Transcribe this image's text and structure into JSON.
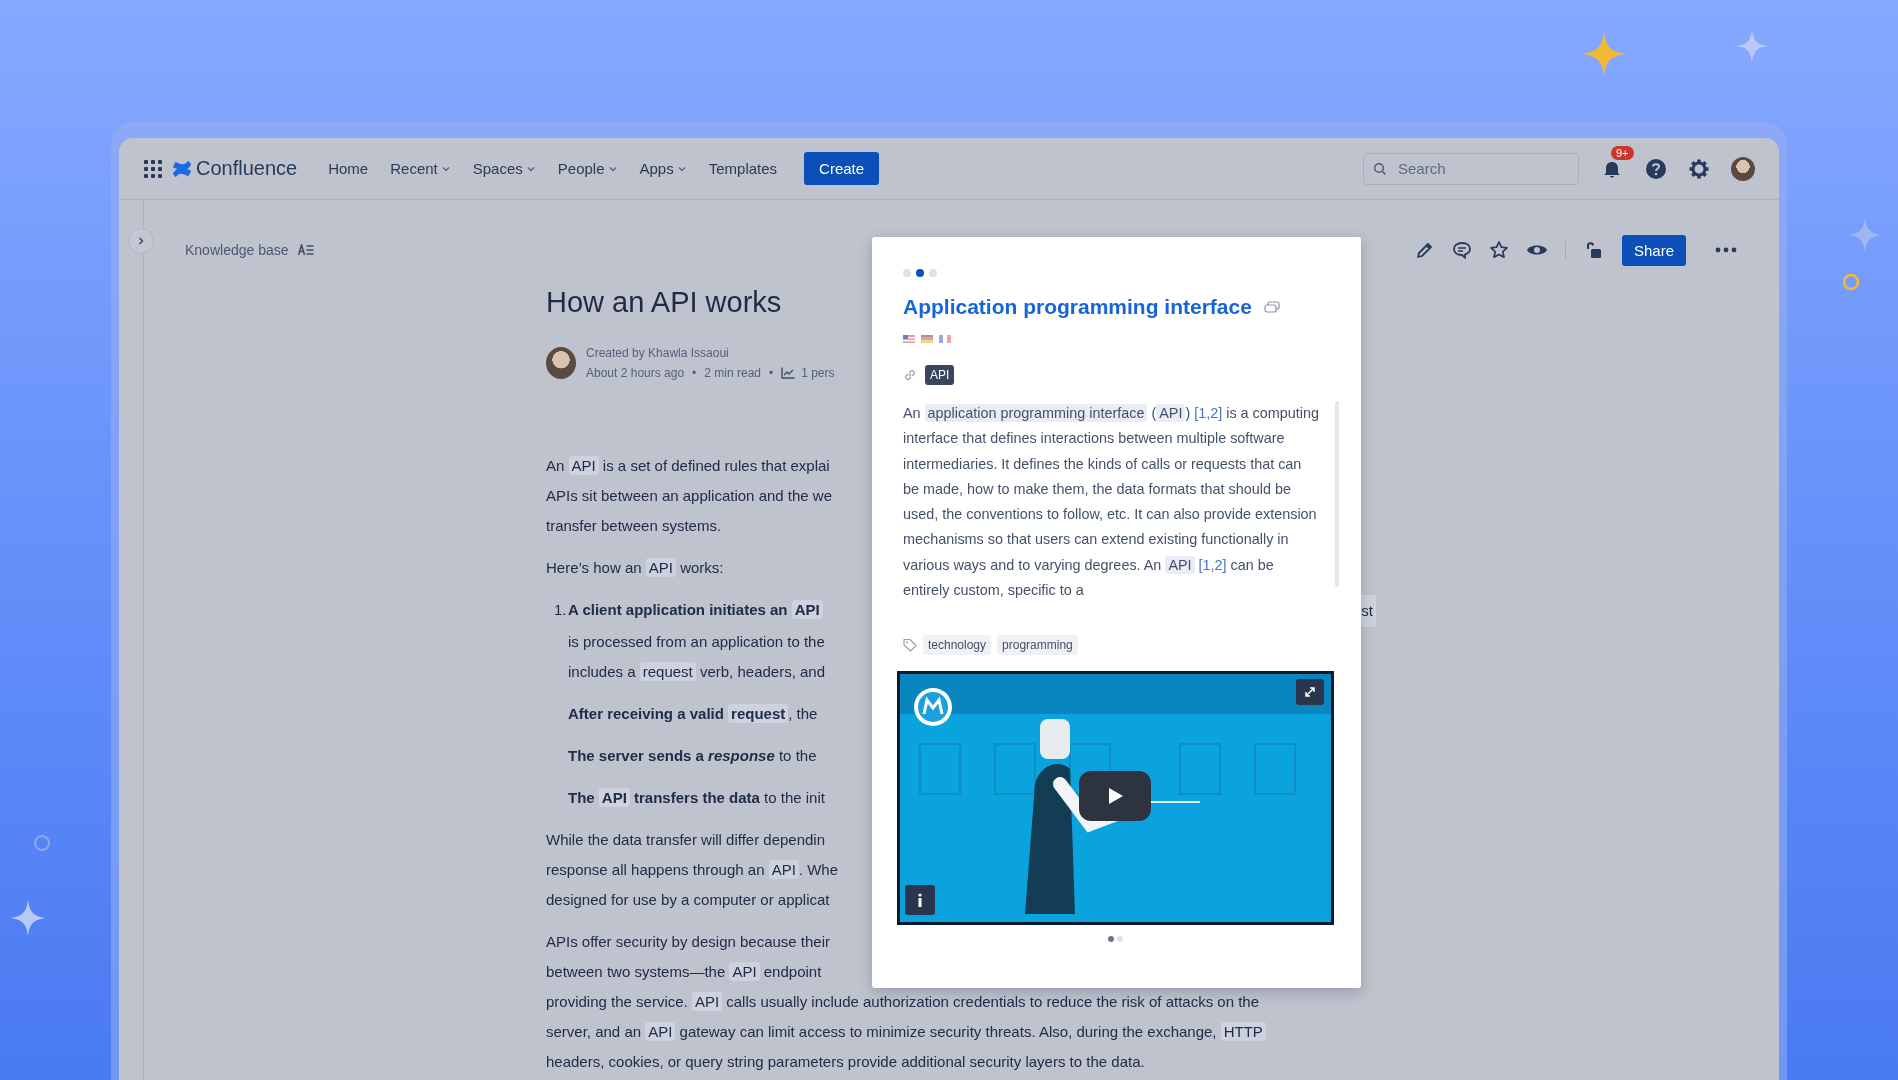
{
  "nav": {
    "product": "Confluence",
    "items": [
      {
        "label": "Home",
        "menu": false
      },
      {
        "label": "Recent",
        "menu": true
      },
      {
        "label": "Spaces",
        "menu": true
      },
      {
        "label": "People",
        "menu": true
      },
      {
        "label": "Apps",
        "menu": true
      },
      {
        "label": "Templates",
        "menu": false
      }
    ],
    "create": "Create",
    "search": {
      "placeholder": "Search"
    },
    "notifications": {
      "badge": "9+"
    }
  },
  "breadcrumb": "Knowledge base",
  "toolbar": {
    "share": "Share"
  },
  "page": {
    "title": "How an API works",
    "author": "Created by Khawla Issaoui",
    "meta": [
      "About 2 hours ago",
      "2 min read"
    ],
    "separator": "•",
    "views": "1 pers",
    "blocks": [
      {
        "kind": "para",
        "lines": [
          {
            "segments": [
              {
                "kind": "plain",
                "text": "An "
              },
              {
                "kind": "term",
                "text": "API"
              },
              {
                "kind": "plain",
                "text": " is a set of defined rules that explai"
              }
            ]
          },
          {
            "segments": [
              {
                "kind": "plain",
                "text": "APIs sit between an application and the we"
              }
            ]
          },
          {
            "segments": [
              {
                "kind": "plain",
                "text": "transfer between systems."
              }
            ]
          }
        ]
      },
      {
        "kind": "para",
        "lines": [
          {
            "segments": [
              {
                "kind": "plain",
                "text": "Here’s how an "
              },
              {
                "kind": "term",
                "text": "API"
              },
              {
                "kind": "plain",
                "text": " works:"
              }
            ]
          }
        ]
      },
      {
        "kind": "item",
        "number": "1.",
        "lines": [
          {
            "segments": [
              {
                "kind": "bold",
                "text": "A client application initiates an "
              },
              {
                "kind": "bold_term",
                "text": "API"
              }
            ],
            "trailing": "st"
          },
          {
            "segments": [
              {
                "kind": "plain",
                "text": "is processed from an application to the"
              }
            ]
          },
          {
            "segments": [
              {
                "kind": "plain",
                "text": "includes a "
              },
              {
                "kind": "term",
                "text": "request"
              },
              {
                "kind": "plain",
                "text": " verb, headers, and"
              }
            ]
          }
        ]
      },
      {
        "kind": "sub",
        "lines": [
          {
            "segments": [
              {
                "kind": "bold",
                "text": "After receiving a valid "
              },
              {
                "kind": "bold_term",
                "text": "request"
              },
              {
                "kind": "plain",
                "text": ", the"
              }
            ]
          }
        ]
      },
      {
        "kind": "sub",
        "lines": [
          {
            "segments": [
              {
                "kind": "bold",
                "text": "The server sends a "
              },
              {
                "kind": "bold_italic",
                "text": "response"
              },
              {
                "kind": "plain",
                "text": " to the"
              }
            ]
          }
        ]
      },
      {
        "kind": "sub",
        "lines": [
          {
            "segments": [
              {
                "kind": "bold",
                "text": "The "
              },
              {
                "kind": "bold_term",
                "text": "API"
              },
              {
                "kind": "bold",
                "text": " transfers the data"
              },
              {
                "kind": "plain",
                "text": " to the init"
              }
            ]
          }
        ]
      },
      {
        "kind": "para",
        "lines": [
          {
            "segments": [
              {
                "kind": "plain",
                "text": "While the data transfer will differ dependin"
              }
            ]
          },
          {
            "segments": [
              {
                "kind": "plain",
                "text": "response all happens through an "
              },
              {
                "kind": "term",
                "text": "API"
              },
              {
                "kind": "plain",
                "text": ". Whe"
              }
            ]
          },
          {
            "segments": [
              {
                "kind": "plain",
                "text": "designed for use by a computer or applicat"
              }
            ]
          }
        ]
      },
      {
        "kind": "para",
        "lines": [
          {
            "segments": [
              {
                "kind": "plain",
                "text": "APIs offer security by design because their"
              }
            ]
          },
          {
            "segments": [
              {
                "kind": "plain",
                "text": "between two systems—the "
              },
              {
                "kind": "term",
                "text": "API"
              },
              {
                "kind": "plain",
                "text": " endpoint"
              }
            ]
          },
          {
            "segments": [
              {
                "kind": "plain",
                "text": "providing the service. "
              },
              {
                "kind": "term",
                "text": "API"
              },
              {
                "kind": "plain",
                "text": " calls usually include authorization credentials to reduce the risk of attacks on the"
              }
            ]
          },
          {
            "segments": [
              {
                "kind": "plain",
                "text": "server, and an "
              },
              {
                "kind": "term",
                "text": "API"
              },
              {
                "kind": "plain",
                "text": " gateway can limit access to minimize security threats. Also, during the exchange, "
              },
              {
                "kind": "term",
                "text": "HTTP"
              }
            ]
          },
          {
            "segments": [
              {
                "kind": "plain",
                "text": "headers, cookies, or query string parameters provide additional security layers to the data."
              }
            ]
          }
        ]
      }
    ]
  },
  "popup": {
    "dots": [
      {
        "selected": false
      },
      {
        "selected": true
      },
      {
        "selected": false
      }
    ],
    "title": "Application programming interface",
    "tag": "API",
    "definition": [
      {
        "kind": "plain",
        "text": "An "
      },
      {
        "kind": "term",
        "text": "application programming interface"
      },
      {
        "kind": "plain",
        "text": " ("
      },
      {
        "kind": "term",
        "text": "API"
      },
      {
        "kind": "plain",
        "text": ") "
      },
      {
        "kind": "cite",
        "text": "[1,2]"
      },
      {
        "kind": "plain",
        "text": " is a computing interface that defines interactions between multiple software intermediaries. It defines the kinds of calls or requests that can be made, how to make them, the data formats that should be used, the conventions to follow, etc. It can also provide extension mechanisms so that users can extend existing functionally in various ways and to varying degrees. An "
      },
      {
        "kind": "term",
        "text": "API"
      },
      {
        "kind": "cite",
        "text": " [1,2]"
      },
      {
        "kind": "plain",
        "text": " can be entirely custom, specific to a"
      }
    ],
    "labels": [
      "technology",
      "programming"
    ],
    "video_dots": [
      {
        "selected": true
      },
      {
        "selected": false
      }
    ]
  }
}
